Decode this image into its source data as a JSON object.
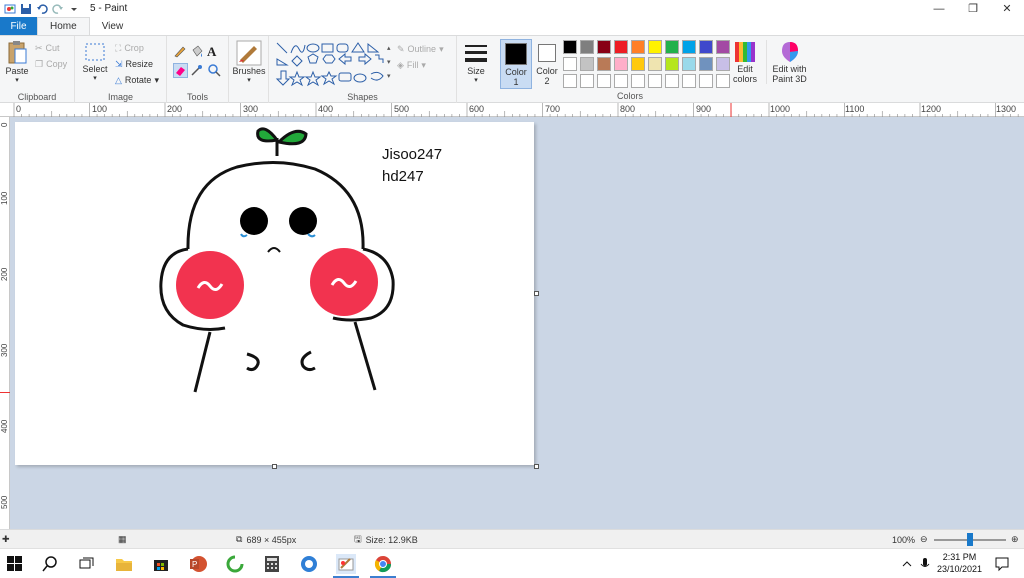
{
  "window": {
    "title": "5 - Paint"
  },
  "tabs": {
    "file": "File",
    "home": "Home",
    "view": "View"
  },
  "ribbon": {
    "clipboard": {
      "paste": "Paste",
      "cut": "Cut",
      "copy": "Copy",
      "label": "Clipboard"
    },
    "image": {
      "select": "Select",
      "crop": "Crop",
      "resize": "Resize",
      "rotate": "Rotate",
      "label": "Image"
    },
    "tools": {
      "label": "Tools"
    },
    "brushes": {
      "label": "Brushes"
    },
    "shapes": {
      "outline": "Outline",
      "fill": "Fill",
      "label": "Shapes"
    },
    "size": {
      "label": "Size"
    },
    "color1": {
      "line1": "Color",
      "line2": "1",
      "value": "#000000"
    },
    "color2": {
      "line1": "Color",
      "line2": "2",
      "value": "#ffffff"
    },
    "colors": {
      "label": "Colors",
      "edit": [
        "Edit",
        "colors"
      ],
      "palette": [
        "#000000",
        "#7f7f7f",
        "#880015",
        "#ed1c24",
        "#ff7f27",
        "#fff200",
        "#22b14c",
        "#00a2e8",
        "#3f48cc",
        "#a349a4",
        "#ffffff",
        "#c3c3c3",
        "#b97a57",
        "#ffaec9",
        "#ffc90e",
        "#efe4b0",
        "#b5e61d",
        "#99d9ea",
        "#7092be",
        "#c8bfe7",
        "#ffffff",
        "#ffffff",
        "#ffffff",
        "#ffffff",
        "#ffffff",
        "#ffffff",
        "#ffffff",
        "#ffffff",
        "#ffffff",
        "#ffffff"
      ]
    },
    "paint3d": [
      "Edit with",
      "Paint 3D"
    ]
  },
  "ruler": {
    "top": [
      "0",
      "100",
      "200",
      "300",
      "400",
      "500",
      "600",
      "700",
      "800",
      "900",
      "1000",
      "1100",
      "1200",
      "1300"
    ],
    "left": [
      "0",
      "100",
      "200",
      "300",
      "400",
      "500"
    ]
  },
  "canvas": {
    "text_line1": "Jisoo247",
    "text_line2": "hd247"
  },
  "status": {
    "dimensions": "689 × 455px",
    "size": "Size: 12.9KB",
    "zoom": "100%"
  },
  "taskbar": {
    "time": "2:31 PM",
    "date": "23/10/2021"
  }
}
